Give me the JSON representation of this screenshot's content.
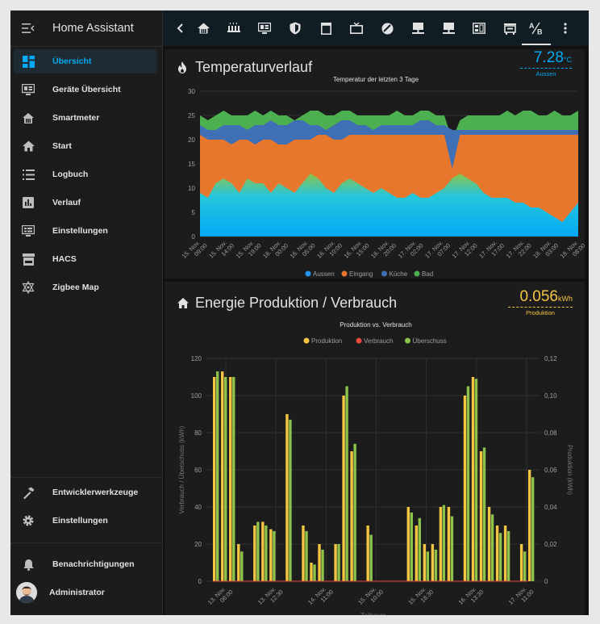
{
  "sidebar": {
    "title": "Home Assistant",
    "items": [
      {
        "label": "Übersicht",
        "icon": "dashboard-icon",
        "active": true
      },
      {
        "label": "Geräte Übersicht",
        "icon": "monitor-dashboard-icon"
      },
      {
        "label": "Smartmeter",
        "icon": "home-meter-icon"
      },
      {
        "label": "Start",
        "icon": "home-icon"
      },
      {
        "label": "Logbuch",
        "icon": "list-icon"
      },
      {
        "label": "Verlauf",
        "icon": "chart-box-icon"
      },
      {
        "label": "Einstellungen",
        "icon": "settings-panel-icon"
      },
      {
        "label": "HACS",
        "icon": "hacs-store-icon"
      },
      {
        "label": "Zigbee Map",
        "icon": "zigbee-map-icon"
      }
    ],
    "bottom_items": [
      {
        "label": "Entwicklerwerkzeuge",
        "icon": "hammer-icon"
      },
      {
        "label": "Einstellungen",
        "icon": "cog-icon"
      },
      {
        "label": "Benachrichtigungen",
        "icon": "bell-icon"
      },
      {
        "label": "Administrator",
        "icon": "avatar"
      }
    ]
  },
  "topbar": {
    "icons": [
      "chevron-left-icon",
      "home-icon",
      "radiator-icon",
      "monitor-icon",
      "shield-icon",
      "window-icon",
      "tv-icon",
      "robot-vacuum-icon",
      "server-icon",
      "server-network-icon",
      "meter-icon",
      "printer-icon",
      "ab-testing-icon",
      "more-vert-icon"
    ],
    "active_index": 12
  },
  "cards": {
    "temperature": {
      "title": "Temperaturverlauf",
      "stat_value": "7.28",
      "stat_unit": "°C",
      "stat_label": "Aussen"
    },
    "energy": {
      "title": "Energie Produktion / Verbrauch",
      "stat_value": "0.056",
      "stat_unit": "kWh",
      "stat_label": "Produktion"
    }
  },
  "colors": {
    "accent": "#03a9f4",
    "aussen": "#2196f3",
    "eingang": "#e8772e",
    "kueche": "#3f6fb5",
    "bad": "#4caf50",
    "produktion": "#f4c542",
    "verbrauch": "#e74c3c",
    "ueberschuss": "#8bc34a"
  },
  "chart_data": [
    {
      "type": "area",
      "title": "Temperatur der letzten 3 Tage",
      "ylim": [
        0,
        30
      ],
      "yticks": [
        0,
        5,
        10,
        15,
        20,
        25,
        30
      ],
      "x_tick_labels": [
        "15. Nov. 09:00",
        "15. Nov. 14:00",
        "15. Nov. 19:00",
        "16. Nov. 00:00",
        "16. Nov. 05:00",
        "16. Nov. 10:00",
        "16. Nov. 15:00",
        "16. Nov. 20:00",
        "17. Nov. 02:00",
        "17. Nov. 07:00",
        "17. Nov. 12:00",
        "17. Nov. 17:00",
        "17. Nov. 22:00",
        "18. Nov. 03:00",
        "18. Nov. 08:00"
      ],
      "legend": [
        "Aussen",
        "Eingang",
        "Küche",
        "Bad"
      ],
      "legend_position": "bottom",
      "x": [
        0,
        1,
        2,
        3,
        4,
        5,
        6,
        7,
        8,
        9,
        10,
        11,
        12,
        13,
        14,
        15,
        16,
        17,
        18,
        19,
        20,
        21,
        22,
        23,
        24,
        25,
        26,
        27,
        28,
        29,
        30,
        31,
        32,
        33,
        34,
        35,
        36,
        37,
        38,
        39,
        40,
        41,
        42,
        43,
        44,
        45,
        46,
        47,
        48
      ],
      "series": [
        {
          "name": "Aussen",
          "values": [
            9,
            8,
            11,
            12,
            11,
            9,
            12,
            11,
            11,
            9,
            11,
            10,
            9,
            11,
            13,
            12,
            10,
            9,
            11,
            12,
            11,
            10,
            9,
            10,
            9,
            8,
            8,
            9,
            8,
            8,
            9,
            10,
            12,
            13,
            12,
            11,
            9,
            8,
            8,
            8,
            7,
            7,
            6,
            6,
            5,
            4,
            3,
            5,
            7
          ]
        },
        {
          "name": "Eingang",
          "values": [
            21,
            20,
            20,
            20,
            19,
            20,
            20,
            19,
            20,
            20,
            19,
            19,
            20,
            20,
            20,
            21,
            21,
            20,
            20,
            21,
            21,
            21,
            21,
            21,
            21,
            21,
            21,
            21,
            21,
            21,
            21,
            21,
            14,
            21,
            21,
            21,
            21,
            21,
            21,
            21,
            21,
            21,
            21,
            21,
            21,
            21,
            21,
            21,
            21
          ]
        },
        {
          "name": "Küche",
          "values": [
            23,
            22,
            22,
            23,
            23,
            23,
            22,
            23,
            23,
            24,
            23,
            23,
            24,
            24,
            23,
            23,
            22,
            23,
            24,
            24,
            23,
            23,
            22,
            23,
            23,
            23,
            23,
            23,
            24,
            24,
            23,
            23,
            22,
            22,
            22,
            22,
            22,
            22,
            22,
            22,
            22,
            22,
            22,
            22,
            22,
            22,
            22,
            22,
            22
          ]
        },
        {
          "name": "Bad",
          "values": [
            25,
            24,
            25,
            26,
            25,
            25,
            25,
            26,
            25,
            26,
            25,
            25,
            24,
            25,
            26,
            26,
            25,
            25,
            26,
            26,
            25,
            25,
            25,
            25,
            25,
            26,
            25,
            25,
            26,
            26,
            25,
            25,
            20,
            24,
            25,
            25,
            25,
            25,
            25,
            26,
            25,
            26,
            26,
            25,
            25,
            26,
            25,
            25,
            26
          ]
        }
      ]
    },
    {
      "type": "bar",
      "title": "Produktion vs. Verbrauch",
      "xlabel": "Zeitraum",
      "ylabel": "Verbrauch / Überschuss (kWh)",
      "ylabel_right": "Produktion (kWh)",
      "ylim": [
        0,
        120
      ],
      "ylim_right": [
        0,
        0.12
      ],
      "yticks": [
        0,
        20,
        40,
        60,
        80,
        100,
        120
      ],
      "yticks_right": [
        "0",
        "0,02",
        "0,04",
        "0,06",
        "0,08",
        "0,10",
        "0,12"
      ],
      "x_tick_labels": [
        "13. Nov. 06:00",
        "13. Nov. 12:30",
        "14. Nov. 11:00",
        "15. Nov. 10:00",
        "15. Nov. 18:30",
        "16. Nov. 13:30",
        "17. Nov. 11:00"
      ],
      "legend": [
        "Produktion",
        "Verbrauch",
        "Überschuss"
      ],
      "legend_position": "top",
      "series": [
        {
          "name": "Produktion",
          "values": [
            110,
            113,
            110,
            20,
            0,
            30,
            32,
            28,
            0,
            90,
            0,
            30,
            10,
            20,
            0,
            20,
            100,
            70,
            0,
            30,
            0,
            0,
            0,
            0,
            40,
            30,
            20,
            20,
            40,
            40,
            0,
            100,
            110,
            70,
            40,
            30,
            30,
            0,
            20,
            60
          ]
        },
        {
          "name": "Verbrauch",
          "values": [
            0,
            0,
            0,
            0,
            0,
            0,
            0,
            0,
            0,
            0,
            0,
            0,
            0,
            0,
            0,
            0,
            0,
            0,
            0,
            0,
            0,
            0,
            0,
            0,
            0,
            0,
            0,
            0,
            0,
            0,
            0,
            0,
            0,
            0,
            0,
            0,
            0,
            0,
            0,
            0
          ]
        },
        {
          "name": "Überschuss",
          "values": [
            113,
            110,
            110,
            16,
            0,
            32,
            30,
            27,
            0,
            87,
            0,
            27,
            9,
            17,
            0,
            20,
            105,
            74,
            0,
            25,
            0,
            0,
            0,
            0,
            37,
            34,
            16,
            17,
            41,
            35,
            0,
            105,
            109,
            72,
            36,
            26,
            27,
            0,
            16,
            56
          ]
        }
      ]
    }
  ]
}
